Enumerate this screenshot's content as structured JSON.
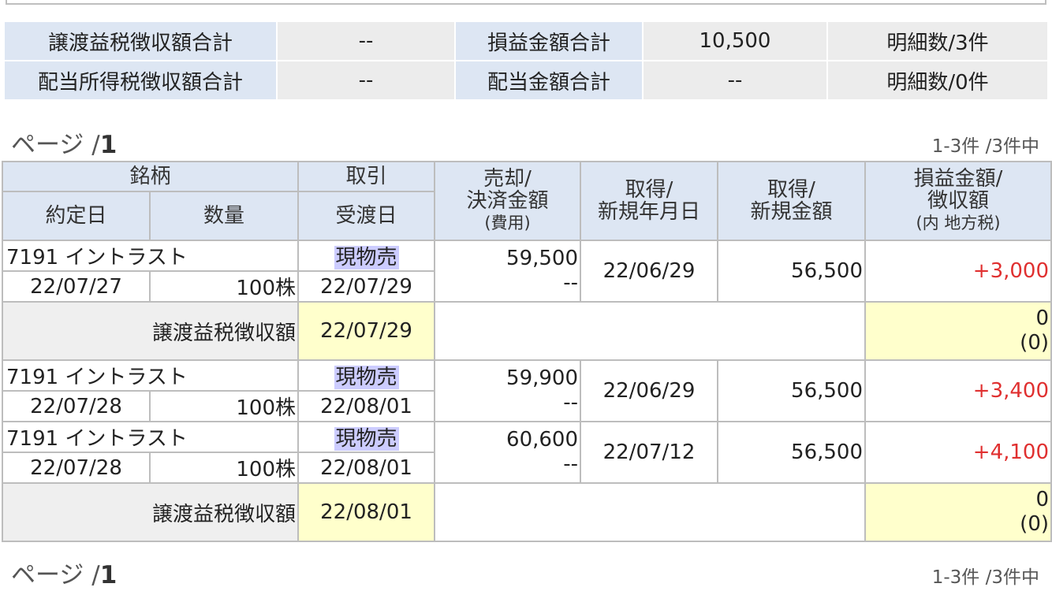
{
  "summary": {
    "row1": {
      "label1": "譲渡益税徴収額合計",
      "value1": "--",
      "label2": "損益金額合計",
      "value2": "10,500",
      "count": "明細数/3件"
    },
    "row2": {
      "label1": "配当所得税徴収額合計",
      "value1": "--",
      "label2": "配当金額合計",
      "value2": "--",
      "count": "明細数/0件"
    }
  },
  "pager": {
    "prefix": "ページ /",
    "page": "1",
    "count": "1-3件 /3件中"
  },
  "headers": {
    "meigara": "銘柄",
    "torihiki": "取引",
    "baikyaku_l1": "売却/",
    "baikyaku_l2": "決済金額",
    "baikyaku_l3": "(費用)",
    "shutoku_l1": "取得/",
    "shutoku_l2": "新規年月日",
    "kingaku_l1": "取得/",
    "kingaku_l2": "新規金額",
    "soneki_l1": "損益金額/",
    "soneki_l2": "徴収額",
    "soneki_l3": "(内 地方税)",
    "yakujo": "約定日",
    "suryo": "数量",
    "ukewatashi": "受渡日"
  },
  "trades": [
    {
      "name": "7191 イントラスト",
      "type": "現物売",
      "yakujo": "22/07/27",
      "qty": "100株",
      "ukewatashi": "22/07/29",
      "sale": "59,500",
      "fee": "--",
      "acq_date": "22/06/29",
      "acq_amount": "56,500",
      "pl": "+3,000"
    },
    {
      "name": "7191 イントラスト",
      "type": "現物売",
      "yakujo": "22/07/28",
      "qty": "100株",
      "ukewatashi": "22/08/01",
      "sale": "59,900",
      "fee": "--",
      "acq_date": "22/06/29",
      "acq_amount": "56,500",
      "pl": "+3,400"
    },
    {
      "name": "7191 イントラスト",
      "type": "現物売",
      "yakujo": "22/07/28",
      "qty": "100株",
      "ukewatashi": "22/08/01",
      "sale": "60,600",
      "fee": "--",
      "acq_date": "22/07/12",
      "acq_amount": "56,500",
      "pl": "+4,100"
    }
  ],
  "tax_rows": [
    {
      "label": "譲渡益税徴収額",
      "date": "22/07/29",
      "amount": "0",
      "local": "(0)"
    },
    {
      "label": "譲渡益税徴収額",
      "date": "22/08/01",
      "amount": "0",
      "local": "(0)"
    }
  ]
}
